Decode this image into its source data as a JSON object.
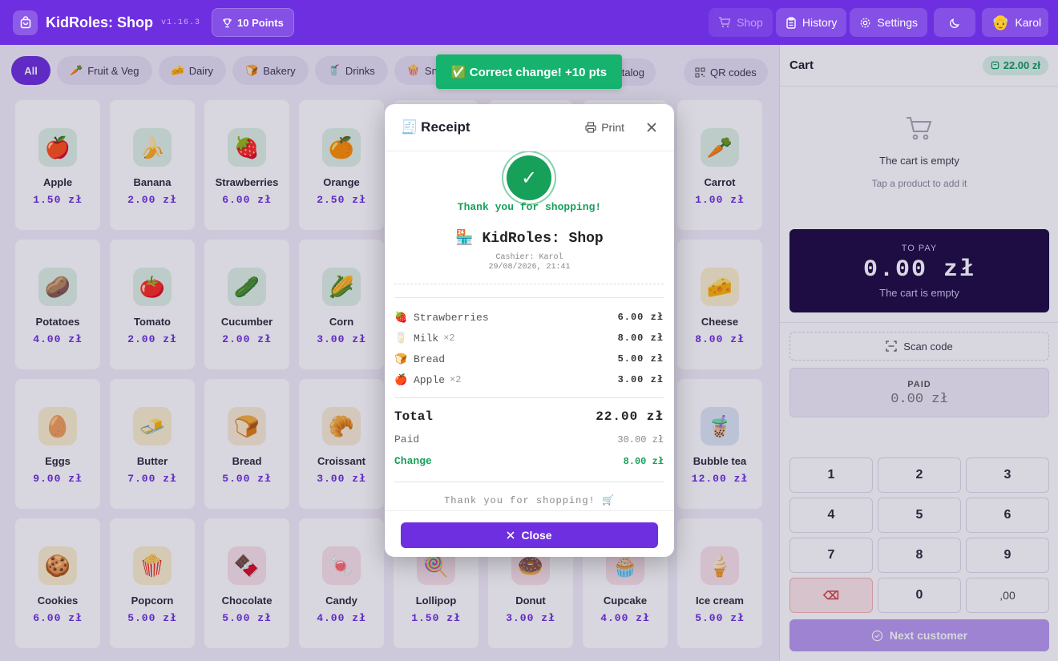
{
  "header": {
    "title": "KidRoles: Shop",
    "version": "v1.16.3",
    "points": "10 Points",
    "nav": {
      "shop": "Shop",
      "history": "History",
      "settings": "Settings"
    },
    "user": {
      "name": "Karol",
      "avatar": "👴"
    }
  },
  "categories": [
    {
      "label": "All",
      "emoji": ""
    },
    {
      "label": "Fruit & Veg",
      "emoji": "🥕"
    },
    {
      "label": "Dairy",
      "emoji": "🧀"
    },
    {
      "label": "Bakery",
      "emoji": "🍞"
    },
    {
      "label": "Drinks",
      "emoji": "🥤"
    },
    {
      "label": "Snacks",
      "emoji": "🍿"
    }
  ],
  "catalog_actions": {
    "edit": "Edit catalog",
    "qr": "QR codes"
  },
  "products": [
    {
      "name": "Apple",
      "price": "1.50 zł",
      "emoji": "🍎",
      "bg": "#dff3e6"
    },
    {
      "name": "Banana",
      "price": "2.00 zł",
      "emoji": "🍌",
      "bg": "#dff3e6"
    },
    {
      "name": "Strawberries",
      "price": "6.00 zł",
      "emoji": "🍓",
      "bg": "#dff3e6"
    },
    {
      "name": "Orange",
      "price": "2.50 zł",
      "emoji": "🍊",
      "bg": "#dff3e6"
    },
    {
      "name": "",
      "price": "",
      "emoji": "",
      "bg": "#fff"
    },
    {
      "name": "",
      "price": "",
      "emoji": "",
      "bg": "#fff"
    },
    {
      "name": "",
      "price": "",
      "emoji": "",
      "bg": "#fff"
    },
    {
      "name": "Carrot",
      "price": "1.00 zł",
      "emoji": "🥕",
      "bg": "#dff3e6"
    },
    {
      "name": "Potatoes",
      "price": "4.00 zł",
      "emoji": "🥔",
      "bg": "#dff3e6"
    },
    {
      "name": "Tomato",
      "price": "2.00 zł",
      "emoji": "🍅",
      "bg": "#dff3e6"
    },
    {
      "name": "Cucumber",
      "price": "2.00 zł",
      "emoji": "🥒",
      "bg": "#dff3e6"
    },
    {
      "name": "Corn",
      "price": "3.00 zł",
      "emoji": "🌽",
      "bg": "#dff3e6"
    },
    {
      "name": "",
      "price": "",
      "emoji": "",
      "bg": "#fff"
    },
    {
      "name": "",
      "price": "",
      "emoji": "",
      "bg": "#fff"
    },
    {
      "name": "",
      "price": "",
      "emoji": "",
      "bg": "#fff"
    },
    {
      "name": "Cheese",
      "price": "8.00 zł",
      "emoji": "🧀",
      "bg": "#fbf1cf"
    },
    {
      "name": "Eggs",
      "price": "9.00 zł",
      "emoji": "🥚",
      "bg": "#fbf1cf"
    },
    {
      "name": "Butter",
      "price": "7.00 zł",
      "emoji": "🧈",
      "bg": "#fbf1cf"
    },
    {
      "name": "Bread",
      "price": "5.00 zł",
      "emoji": "🍞",
      "bg": "#fbeed7"
    },
    {
      "name": "Croissant",
      "price": "3.00 zł",
      "emoji": "🥐",
      "bg": "#fbeed7"
    },
    {
      "name": "",
      "price": "",
      "emoji": "",
      "bg": "#fff"
    },
    {
      "name": "",
      "price": "",
      "emoji": "",
      "bg": "#fff"
    },
    {
      "name": "",
      "price": "",
      "emoji": "",
      "bg": "#fff"
    },
    {
      "name": "Bubble tea",
      "price": "12.00 zł",
      "emoji": "🧋",
      "bg": "#dfe8f7"
    },
    {
      "name": "Cookies",
      "price": "6.00 zł",
      "emoji": "🍪",
      "bg": "#fbf1cf"
    },
    {
      "name": "Popcorn",
      "price": "5.00 zł",
      "emoji": "🍿",
      "bg": "#fbf1cf"
    },
    {
      "name": "Chocolate",
      "price": "5.00 zł",
      "emoji": "🍫",
      "bg": "#fbe3ea"
    },
    {
      "name": "Candy",
      "price": "4.00 zł",
      "emoji": "🍬",
      "bg": "#fbe3ea"
    },
    {
      "name": "Lollipop",
      "price": "1.50 zł",
      "emoji": "🍭",
      "bg": "#fbe3ea"
    },
    {
      "name": "Donut",
      "price": "3.00 zł",
      "emoji": "🍩",
      "bg": "#fbe3ea"
    },
    {
      "name": "Cupcake",
      "price": "4.00 zł",
      "emoji": "🧁",
      "bg": "#fbe3ea"
    },
    {
      "name": "Ice cream",
      "price": "5.00 zł",
      "emoji": "🍦",
      "bg": "#fbe3ea"
    }
  ],
  "cart": {
    "title": "Cart",
    "total": "22.00 zł",
    "empty_title": "The cart is empty",
    "empty_sub": "Tap a product to add it",
    "to_pay_label": "TO PAY",
    "to_pay_value": "0.00 zł",
    "to_pay_sub": "The cart is empty",
    "scan": "Scan code",
    "paid_label": "PAID",
    "paid_value": "0.00 zł",
    "keys": [
      "1",
      "2",
      "3",
      "4",
      "5",
      "6",
      "7",
      "8",
      "9",
      "⌫",
      "0",
      ",00"
    ],
    "next": "Next customer"
  },
  "toast": "✅ Correct change! +10 pts",
  "receipt": {
    "title": "Receipt",
    "title_emoji": "🧾",
    "print": "Print",
    "check": "✓",
    "thanks_top": "Thank you for shopping!",
    "shop_name": "KidRoles: Shop",
    "shop_emoji": "🏪",
    "cashier": "Cashier: Karol",
    "datetime": "29/08/2026, 21:41",
    "items": [
      {
        "emoji": "🍓",
        "name": "Strawberries",
        "qty": "",
        "price": "6.00 zł"
      },
      {
        "emoji": "🥛",
        "name": "Milk",
        "qty": "×2",
        "price": "8.00 zł"
      },
      {
        "emoji": "🍞",
        "name": "Bread",
        "qty": "",
        "price": "5.00 zł"
      },
      {
        "emoji": "🍎",
        "name": "Apple",
        "qty": "×2",
        "price": "3.00 zł"
      }
    ],
    "total_label": "Total",
    "total_value": "22.00 zł",
    "paid_label": "Paid",
    "paid_value": "30.00 zł",
    "change_label": "Change",
    "change_value": "8.00 zł",
    "thanks_bottom": "Thank you for shopping! 🛒",
    "close": "Close"
  }
}
